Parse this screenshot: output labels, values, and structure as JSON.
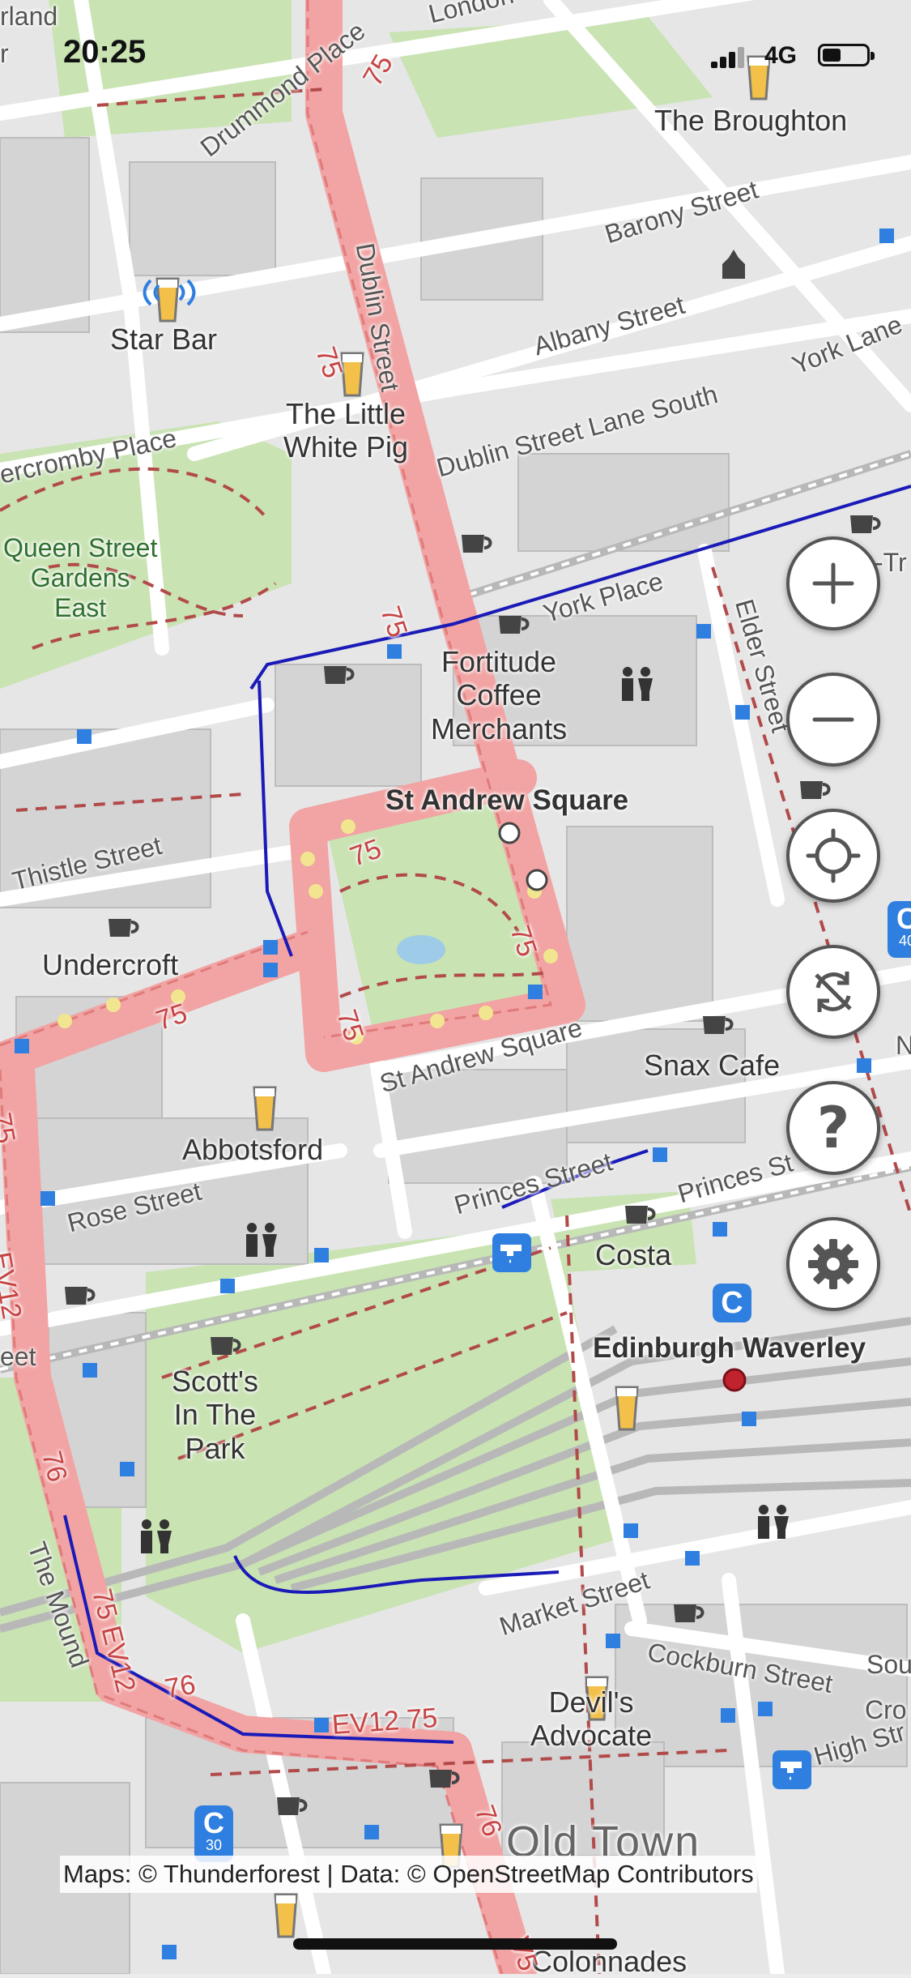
{
  "status_bar": {
    "time": "20:25",
    "network": "4G"
  },
  "places": {
    "the_broughton": "The Broughton",
    "star_bar": "Star Bar",
    "little_white_pig": "The Little\nWhite Pig",
    "fortitude": "Fortitude\nCoffee\nMerchants",
    "st_andrew_square": "St Andrew Square",
    "undercroft": "Undercroft",
    "snax_cafe": "Snax Cafe",
    "abbotsford": "Abbotsford",
    "costa": "Costa",
    "edinburgh_waverley": "Edinburgh Waverley",
    "scotts_in_the_park": "Scott's\nIn The\nPark",
    "devils_advocate": "Devil's\nAdvocate",
    "old_town": "Old Town",
    "colonnades": "Colonnades",
    "queen_street_gardens": "Queen Street\nGardens\nEast"
  },
  "streets": {
    "drummond_place": "Drummond Place",
    "london": "London",
    "rland": "rland",
    "r_edge": "r",
    "barony_street": "Barony Street",
    "albany_street": "Albany Street",
    "york_lane": "York Lane",
    "dublin_street": "Dublin Street",
    "dublin_street_lane_south": "Dublin Street Lane South",
    "abercromby_place": "ercromby Place",
    "york_place": "York Place",
    "elder_street": "Elder Street",
    "thistle_street": "Thistle Street",
    "st_andrew_square_street": "St Andrew Square",
    "rose_street": "Rose Street",
    "princes_street": "Princes Street",
    "princes_street_east": "Princes St",
    "market_street": "Market Street",
    "cockburn_street": "Cockburn Street",
    "the_mound": "The Mound",
    "high_street": "High Str",
    "sou": "Sou",
    "cro": "Cro",
    "eet": "eet",
    "tr": "-Tr",
    "n_edge": "N"
  },
  "routes": [
    "75",
    "75",
    "75",
    "75",
    "75",
    "75",
    "75",
    "EV12",
    "76",
    "75 EV12",
    "76",
    "EV12 75",
    "76",
    "75",
    "V5"
  ],
  "bus_badges": {
    "c": "C",
    "c30": "30",
    "c40": "40"
  },
  "controls": {
    "zoom_in": "+",
    "zoom_out": "−",
    "locate": "locate-icon",
    "rotate": "rotate-lock-icon",
    "help": "?",
    "settings": "gear-icon"
  },
  "attribution": "Maps: © Thunderforest | Data: © OpenStreetMap Contributors",
  "colors": {
    "road_major": "#f2a3a3",
    "road_minor": "#ffffff",
    "park": "#cde6b8",
    "building": "#d9d9d9",
    "rail": "#bdbdbd",
    "bus_route": "#1a1ab8",
    "poi_blue": "#2f7fe0"
  }
}
